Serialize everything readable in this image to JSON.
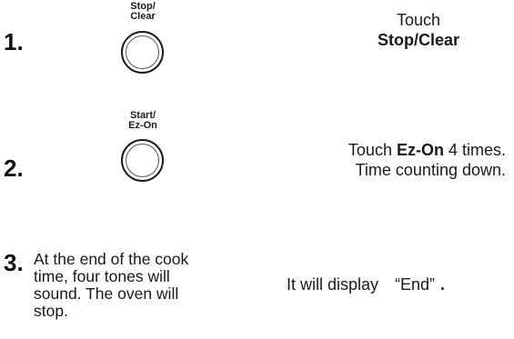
{
  "steps": [
    {
      "number": "1.",
      "button_label_line1": "Stop/",
      "button_label_line2": "Clear",
      "instruction_line1": "Touch",
      "instruction_line2": "Stop/Clear"
    },
    {
      "number": "2.",
      "button_label_line1": "Start/",
      "button_label_line2": "Ez-On",
      "instruction_pre": "Touch ",
      "instruction_bold": "Ez-On",
      "instruction_post": " 4 times.",
      "instruction_line2": "Time counting down."
    },
    {
      "number": "3.",
      "text_line1": "At the end of the cook",
      "text_line2": "time, four tones will",
      "text_line3": "sound. The oven will",
      "text_line4": "stop.",
      "result_pre": "It will display",
      "result_quoted": "“End”",
      "result_post": "."
    }
  ]
}
